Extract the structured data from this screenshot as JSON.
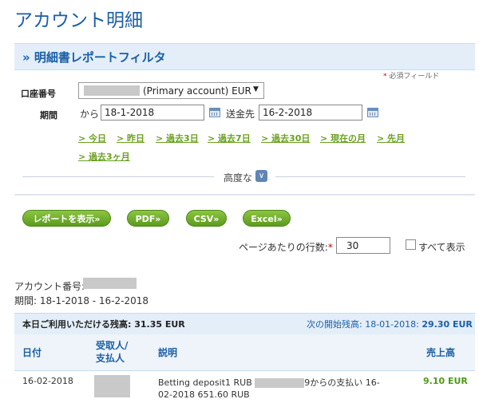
{
  "page": {
    "title": "アカウント明細"
  },
  "filter": {
    "title": "» 明細書レポートフィルタ",
    "required_mark": "*",
    "required_note": "必須フィールド",
    "account_label": "口座番号",
    "account_value": "(Primary account) EUR",
    "account_arrow": "▼",
    "period_label": "期間",
    "from_label": "から",
    "from_date": "18-1-2018",
    "to_label": "送金先",
    "to_date": "16-2-2018",
    "quick_links": [
      "> 今日",
      "> 昨日",
      "> 過去3日",
      "> 過去7日",
      "> 過去30日",
      "> 現在の月",
      "> 先月",
      "> 過去3ヶ月"
    ],
    "advanced_label": "高度な",
    "advanced_icon": "double-chevron-down-icon"
  },
  "actions": {
    "show_report": "レポートを表示»",
    "pdf": "PDF»",
    "csv": "CSV»",
    "excel": "Excel»",
    "rows_label": "ページあたりの行数:",
    "rows_required": "*",
    "rows_value": "30",
    "show_all_label": "すべて表示"
  },
  "summary": {
    "account_number_label": "アカウント番号:",
    "period_text": "期間: 18-1-2018 - 16-2-2018",
    "available_balance": "本日ご利用いただける残高: 31.35 EUR",
    "opening_balance_label": "次の開始残高: 18-01-2018:",
    "opening_balance_value": "29.30 EUR"
  },
  "table": {
    "headers": {
      "date": "日付",
      "payee_line1": "受取人/",
      "payee_line2": "支払人",
      "description": "説明",
      "amount": "売上高"
    },
    "rows": [
      {
        "date": "16-02-2018",
        "desc_prefix": "Betting deposit1 RUB",
        "desc_suffix": "9からの支払い 16-02-2018 651.60 RUB",
        "amount": "9.10 EUR"
      }
    ]
  }
}
